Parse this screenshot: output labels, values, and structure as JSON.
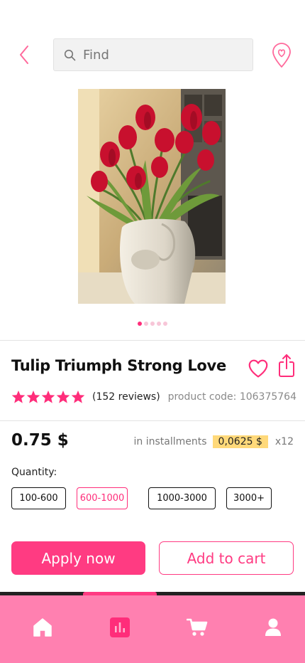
{
  "header": {
    "search_placeholder": "Find",
    "back_icon": "chevron-left-icon",
    "location_icon": "location-heart-icon"
  },
  "gallery": {
    "image": "tulips-in-vase-photo",
    "slide_count": 5,
    "active_slide": 0
  },
  "product": {
    "title": "Tulip Triumph Strong Love",
    "rating_stars": 5,
    "reviews": "(152 reviews)",
    "code": "product code: 106375764",
    "price": "0.75 $",
    "installments_label": "in installments",
    "installment_amount": "0,0625 $",
    "installment_multiplier": "x12"
  },
  "quantity": {
    "label": "Quantity:",
    "options": [
      "100-600",
      "600-1000",
      "1000-3000",
      "3000+"
    ],
    "selected": "600-1000"
  },
  "actions": {
    "apply_label": "Apply now",
    "cart_label": "Add to cart"
  },
  "nav": {
    "items": [
      "home-icon",
      "stats-icon",
      "cart-icon",
      "profile-icon"
    ],
    "active": "stats-icon"
  },
  "colors": {
    "accent": "#ff3b82",
    "nav_background": "#ff80b0",
    "installment_highlight": "#ffd97a"
  }
}
